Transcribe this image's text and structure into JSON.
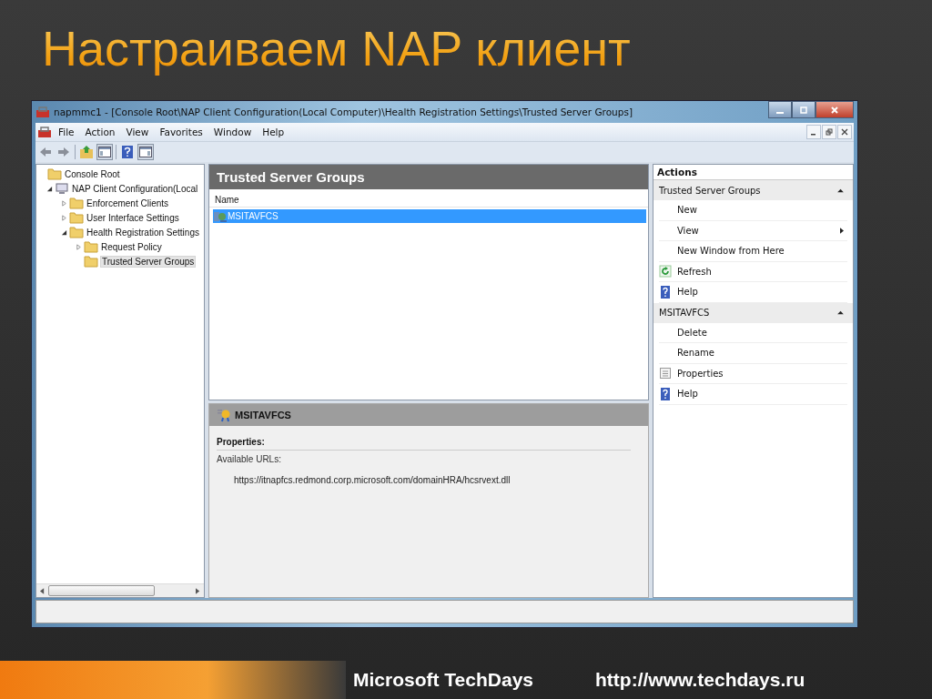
{
  "slide": {
    "title": "Настраиваем NAP клиент",
    "footer": {
      "brand": "Microsoft TechDays",
      "url": "http://www.techdays.ru"
    }
  },
  "window": {
    "title": "napmmc1 - [Console Root\\NAP Client Configuration(Local Computer)\\Health Registration Settings\\Trusted Server Groups]",
    "menu": [
      "File",
      "Action",
      "View",
      "Favorites",
      "Window",
      "Help"
    ],
    "tree": [
      {
        "label": "Console Root",
        "selected": false,
        "children": [
          {
            "label": "NAP Client Configuration(Local",
            "selected": false,
            "expanded": true,
            "children": [
              {
                "label": "Enforcement Clients",
                "selected": false,
                "expanded": false
              },
              {
                "label": "User Interface Settings",
                "selected": false,
                "expanded": false
              },
              {
                "label": "Health Registration Settings",
                "selected": false,
                "expanded": true,
                "children": [
                  {
                    "label": "Request Policy",
                    "selected": false,
                    "expanded": false
                  },
                  {
                    "label": "Trusted Server Groups",
                    "selected": true
                  }
                ]
              }
            ]
          }
        ]
      }
    ],
    "list": {
      "title": "Trusted Server Groups",
      "column": "Name",
      "rows": [
        {
          "name": "MSITAVFCS",
          "selected": true
        }
      ]
    },
    "detail": {
      "title": "MSITAVFCS",
      "properties_label": "Properties:",
      "urls_label": "Available URLs:",
      "url": "https://itnapfcs.redmond.corp.microsoft.com/domainHRA/hcsrvext.dll"
    },
    "actions": {
      "header": "Actions",
      "groups": [
        {
          "title": "Trusted Server Groups",
          "expanded": true,
          "items": [
            {
              "label": "New",
              "kind": "plain"
            },
            {
              "label": "View",
              "kind": "submenu"
            },
            {
              "label": "New Window from Here",
              "kind": "plain"
            },
            {
              "label": "Refresh",
              "kind": "refresh"
            },
            {
              "label": "Help",
              "kind": "help"
            }
          ]
        },
        {
          "title": "MSITAVFCS",
          "expanded": true,
          "items": [
            {
              "label": "Delete",
              "kind": "plain"
            },
            {
              "label": "Rename",
              "kind": "plain"
            },
            {
              "label": "Properties",
              "kind": "properties"
            },
            {
              "label": "Help",
              "kind": "help"
            }
          ]
        }
      ]
    }
  }
}
